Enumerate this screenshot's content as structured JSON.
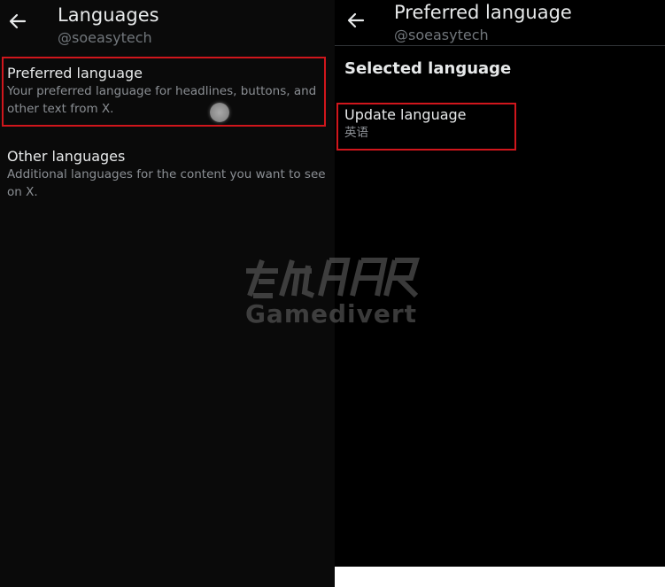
{
  "left": {
    "header": {
      "title": "Languages",
      "handle": "@soeasytech"
    },
    "items": [
      {
        "title": "Preferred language",
        "desc_line1": "Your preferred language for headlines, buttons, and",
        "desc_line2": "other text from X."
      },
      {
        "title": "Other languages",
        "desc_line1": "Additional languages for the content you want to see",
        "desc_line2": "on X."
      }
    ]
  },
  "right": {
    "header": {
      "title": "Preferred language",
      "handle": "@soeasytech"
    },
    "section_title": "Selected language",
    "update": {
      "title": "Update language",
      "value": "英语"
    }
  },
  "watermark": {
    "text": "Gamedivert"
  },
  "colors": {
    "highlight": "#d0161c",
    "background": "#000000",
    "muted_text": "#71767b"
  },
  "icons": {
    "back": "arrow-left-icon",
    "cursor": "touch-indicator"
  }
}
